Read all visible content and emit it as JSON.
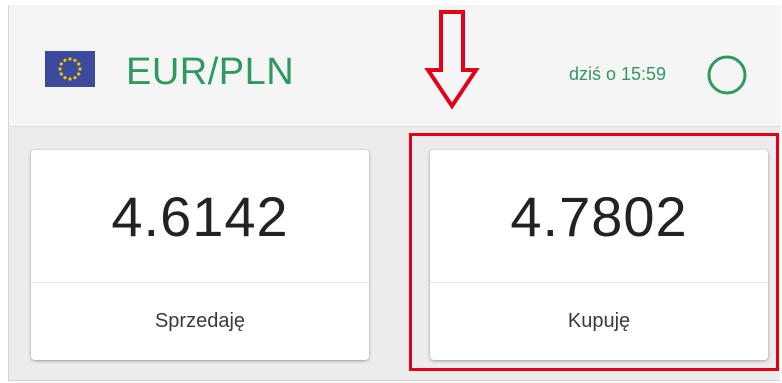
{
  "header": {
    "flag_icon": "eu-flag-icon",
    "pair": "EUR/PLN",
    "timestamp": "dziś o 15:59",
    "refresh_icon": "refresh-ring-icon"
  },
  "cards": {
    "sell": {
      "rate": "4.6142",
      "label": "Sprzedaję"
    },
    "buy": {
      "rate": "4.7802",
      "label": "Kupuję"
    }
  },
  "annotations": {
    "arrow_icon": "down-arrow-icon",
    "highlight_target": "buy-card"
  },
  "colors": {
    "accent": "#2e9a5f",
    "highlight": "#e3001b",
    "flag_blue": "#3b4a9c",
    "flag_star": "#f2c500"
  }
}
